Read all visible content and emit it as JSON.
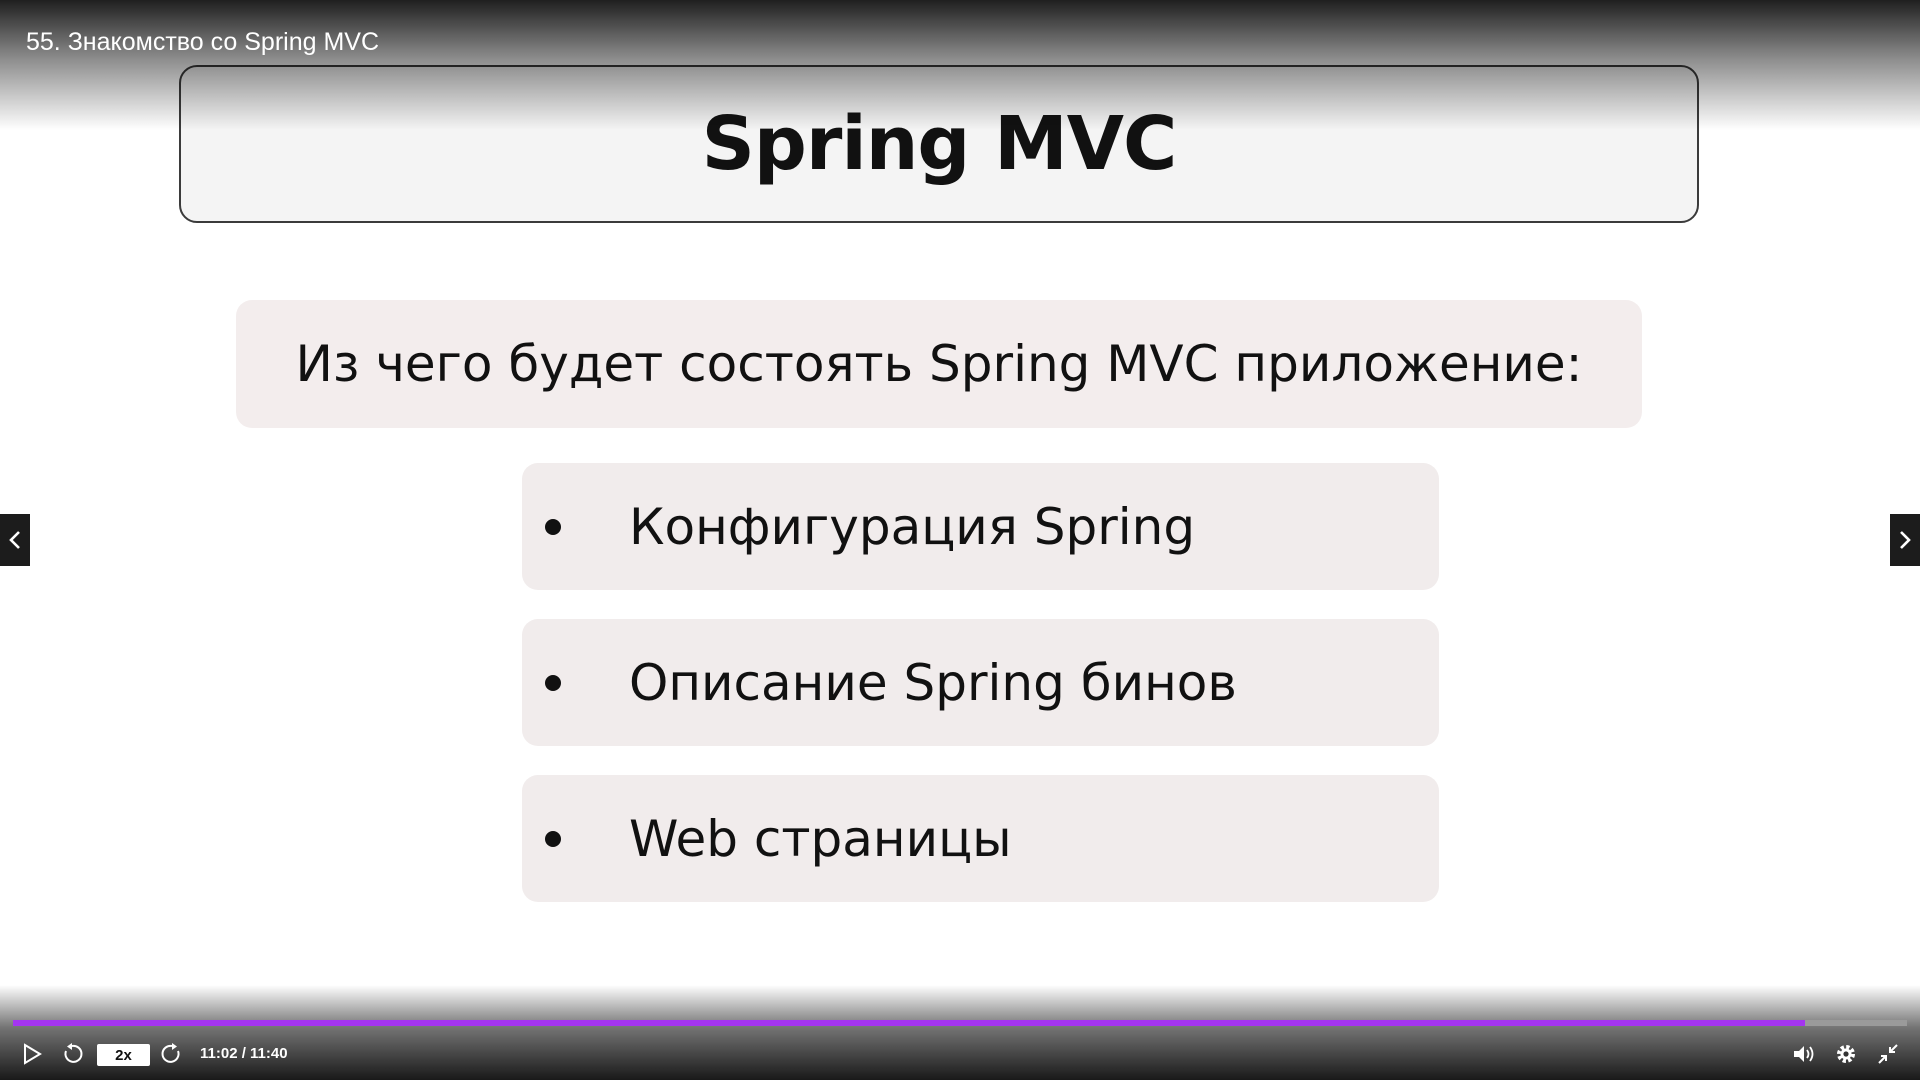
{
  "player": {
    "video_title": "55. Знакомство со Spring MVC",
    "playback_speed": "2x",
    "time_current": "11:02",
    "time_total": "11:40",
    "time_display": "11:02 / 11:40",
    "progress_fraction": 0.946,
    "accent_color": "#a435f0",
    "icons": {
      "play": "play-icon",
      "rewind": "rewind-icon",
      "forward": "forward-icon",
      "volume": "volume-icon",
      "settings": "gear-icon",
      "exit_fullscreen": "exit-fullscreen-icon",
      "prev": "chevron-left-icon",
      "next": "chevron-right-icon"
    }
  },
  "slide": {
    "title": "Spring MVC",
    "heading": "Из чего будет состоять Spring MVC приложение:",
    "bullets": [
      "Конфигурация Spring",
      "Описание Spring бинов",
      "Web страницы"
    ]
  }
}
